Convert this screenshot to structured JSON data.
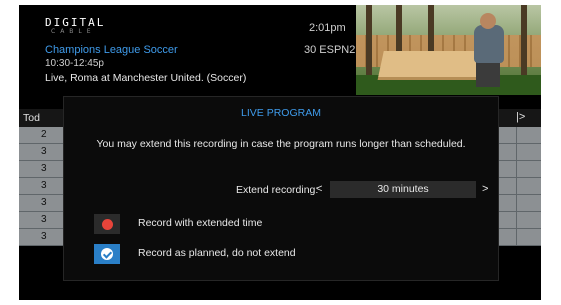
{
  "header": {
    "brand_top": "DIGITAL",
    "brand_bottom": "CABLE",
    "time": "2:01pm",
    "program_title": "Champions League Soccer",
    "channel": "30 ESPN2",
    "program_time": "10:30-12:45p",
    "program_desc": "Live, Roma at Manchester United. (Soccer)"
  },
  "guide": {
    "header_label": "Tod",
    "right_arrow": "|>",
    "rows": [
      "2",
      "3",
      "3",
      "3",
      "3",
      "3",
      "3"
    ]
  },
  "dialog": {
    "title": "LIVE PROGRAM",
    "message": "You may extend this recording in case the program runs longer than scheduled.",
    "extend_label": "Extend recording:",
    "extend_value": "30 minutes",
    "left_chevron": "<",
    "right_chevron": ">",
    "option1": "Record with extended time",
    "option2": "Record as planned, do not extend"
  },
  "colors": {
    "accent_blue": "#3f9bea",
    "selected_blue": "#2a7fc7",
    "record_red": "#e8443a"
  },
  "icons": {
    "option1": "record-dot-icon",
    "option2": "checkmark-icon"
  }
}
